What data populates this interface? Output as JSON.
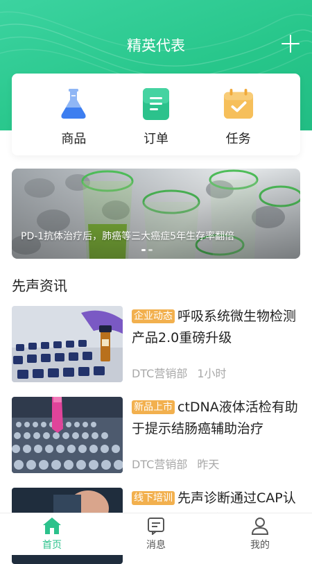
{
  "header": {
    "title": "精英代表",
    "add_icon": "plus-icon"
  },
  "quick_actions": [
    {
      "label": "商品",
      "icon": "flask-icon"
    },
    {
      "label": "订单",
      "icon": "order-document-icon"
    },
    {
      "label": "任务",
      "icon": "calendar-check-icon"
    }
  ],
  "banner": {
    "caption": "PD-1抗体治疗后，肺癌等三大癌症5年生存率翻倍",
    "page_count": 2,
    "active_page": 1
  },
  "section": {
    "title": "先声资讯"
  },
  "news": [
    {
      "tag": "企业动态",
      "title": "呼吸系统微生物检测产品2.0重磅升级",
      "source": "DTC营销部",
      "time": "1小时"
    },
    {
      "tag": "新品上市",
      "title": "ctDNA液体活检有助于提示结肠癌辅助治疗",
      "source": "DTC营销部",
      "time": "昨天"
    },
    {
      "tag": "线下培训",
      "title": "先声诊断通过CAP认证室间质量评审",
      "source": "",
      "time": ""
    }
  ],
  "tabbar": {
    "items": [
      {
        "label": "首页",
        "icon": "home-icon",
        "active": true
      },
      {
        "label": "消息",
        "icon": "message-icon",
        "active": false
      },
      {
        "label": "我的",
        "icon": "profile-icon",
        "active": false
      }
    ]
  },
  "colors": {
    "brand": "#2cc28c",
    "tag": "#f2b04e"
  }
}
